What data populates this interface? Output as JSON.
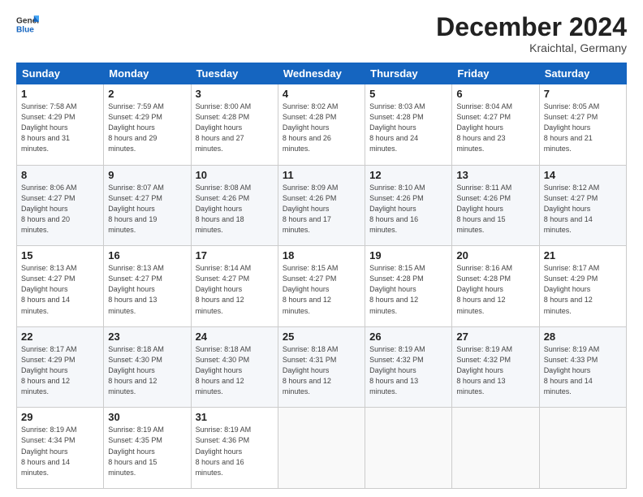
{
  "header": {
    "title": "December 2024",
    "location": "Kraichtal, Germany"
  },
  "weekdays": [
    "Sunday",
    "Monday",
    "Tuesday",
    "Wednesday",
    "Thursday",
    "Friday",
    "Saturday"
  ],
  "weeks": [
    [
      {
        "day": 1,
        "sunrise": "7:58 AM",
        "sunset": "4:29 PM",
        "daylight": "8 hours and 31 minutes."
      },
      {
        "day": 2,
        "sunrise": "7:59 AM",
        "sunset": "4:29 PM",
        "daylight": "8 hours and 29 minutes."
      },
      {
        "day": 3,
        "sunrise": "8:00 AM",
        "sunset": "4:28 PM",
        "daylight": "8 hours and 27 minutes."
      },
      {
        "day": 4,
        "sunrise": "8:02 AM",
        "sunset": "4:28 PM",
        "daylight": "8 hours and 26 minutes."
      },
      {
        "day": 5,
        "sunrise": "8:03 AM",
        "sunset": "4:28 PM",
        "daylight": "8 hours and 24 minutes."
      },
      {
        "day": 6,
        "sunrise": "8:04 AM",
        "sunset": "4:27 PM",
        "daylight": "8 hours and 23 minutes."
      },
      {
        "day": 7,
        "sunrise": "8:05 AM",
        "sunset": "4:27 PM",
        "daylight": "8 hours and 21 minutes."
      }
    ],
    [
      {
        "day": 8,
        "sunrise": "8:06 AM",
        "sunset": "4:27 PM",
        "daylight": "8 hours and 20 minutes."
      },
      {
        "day": 9,
        "sunrise": "8:07 AM",
        "sunset": "4:27 PM",
        "daylight": "8 hours and 19 minutes."
      },
      {
        "day": 10,
        "sunrise": "8:08 AM",
        "sunset": "4:26 PM",
        "daylight": "8 hours and 18 minutes."
      },
      {
        "day": 11,
        "sunrise": "8:09 AM",
        "sunset": "4:26 PM",
        "daylight": "8 hours and 17 minutes."
      },
      {
        "day": 12,
        "sunrise": "8:10 AM",
        "sunset": "4:26 PM",
        "daylight": "8 hours and 16 minutes."
      },
      {
        "day": 13,
        "sunrise": "8:11 AM",
        "sunset": "4:26 PM",
        "daylight": "8 hours and 15 minutes."
      },
      {
        "day": 14,
        "sunrise": "8:12 AM",
        "sunset": "4:27 PM",
        "daylight": "8 hours and 14 minutes."
      }
    ],
    [
      {
        "day": 15,
        "sunrise": "8:13 AM",
        "sunset": "4:27 PM",
        "daylight": "8 hours and 14 minutes."
      },
      {
        "day": 16,
        "sunrise": "8:13 AM",
        "sunset": "4:27 PM",
        "daylight": "8 hours and 13 minutes."
      },
      {
        "day": 17,
        "sunrise": "8:14 AM",
        "sunset": "4:27 PM",
        "daylight": "8 hours and 12 minutes."
      },
      {
        "day": 18,
        "sunrise": "8:15 AM",
        "sunset": "4:27 PM",
        "daylight": "8 hours and 12 minutes."
      },
      {
        "day": 19,
        "sunrise": "8:15 AM",
        "sunset": "4:28 PM",
        "daylight": "8 hours and 12 minutes."
      },
      {
        "day": 20,
        "sunrise": "8:16 AM",
        "sunset": "4:28 PM",
        "daylight": "8 hours and 12 minutes."
      },
      {
        "day": 21,
        "sunrise": "8:17 AM",
        "sunset": "4:29 PM",
        "daylight": "8 hours and 12 minutes."
      }
    ],
    [
      {
        "day": 22,
        "sunrise": "8:17 AM",
        "sunset": "4:29 PM",
        "daylight": "8 hours and 12 minutes."
      },
      {
        "day": 23,
        "sunrise": "8:18 AM",
        "sunset": "4:30 PM",
        "daylight": "8 hours and 12 minutes."
      },
      {
        "day": 24,
        "sunrise": "8:18 AM",
        "sunset": "4:30 PM",
        "daylight": "8 hours and 12 minutes."
      },
      {
        "day": 25,
        "sunrise": "8:18 AM",
        "sunset": "4:31 PM",
        "daylight": "8 hours and 12 minutes."
      },
      {
        "day": 26,
        "sunrise": "8:19 AM",
        "sunset": "4:32 PM",
        "daylight": "8 hours and 13 minutes."
      },
      {
        "day": 27,
        "sunrise": "8:19 AM",
        "sunset": "4:32 PM",
        "daylight": "8 hours and 13 minutes."
      },
      {
        "day": 28,
        "sunrise": "8:19 AM",
        "sunset": "4:33 PM",
        "daylight": "8 hours and 14 minutes."
      }
    ],
    [
      {
        "day": 29,
        "sunrise": "8:19 AM",
        "sunset": "4:34 PM",
        "daylight": "8 hours and 14 minutes."
      },
      {
        "day": 30,
        "sunrise": "8:19 AM",
        "sunset": "4:35 PM",
        "daylight": "8 hours and 15 minutes."
      },
      {
        "day": 31,
        "sunrise": "8:19 AM",
        "sunset": "4:36 PM",
        "daylight": "8 hours and 16 minutes."
      },
      null,
      null,
      null,
      null
    ]
  ]
}
